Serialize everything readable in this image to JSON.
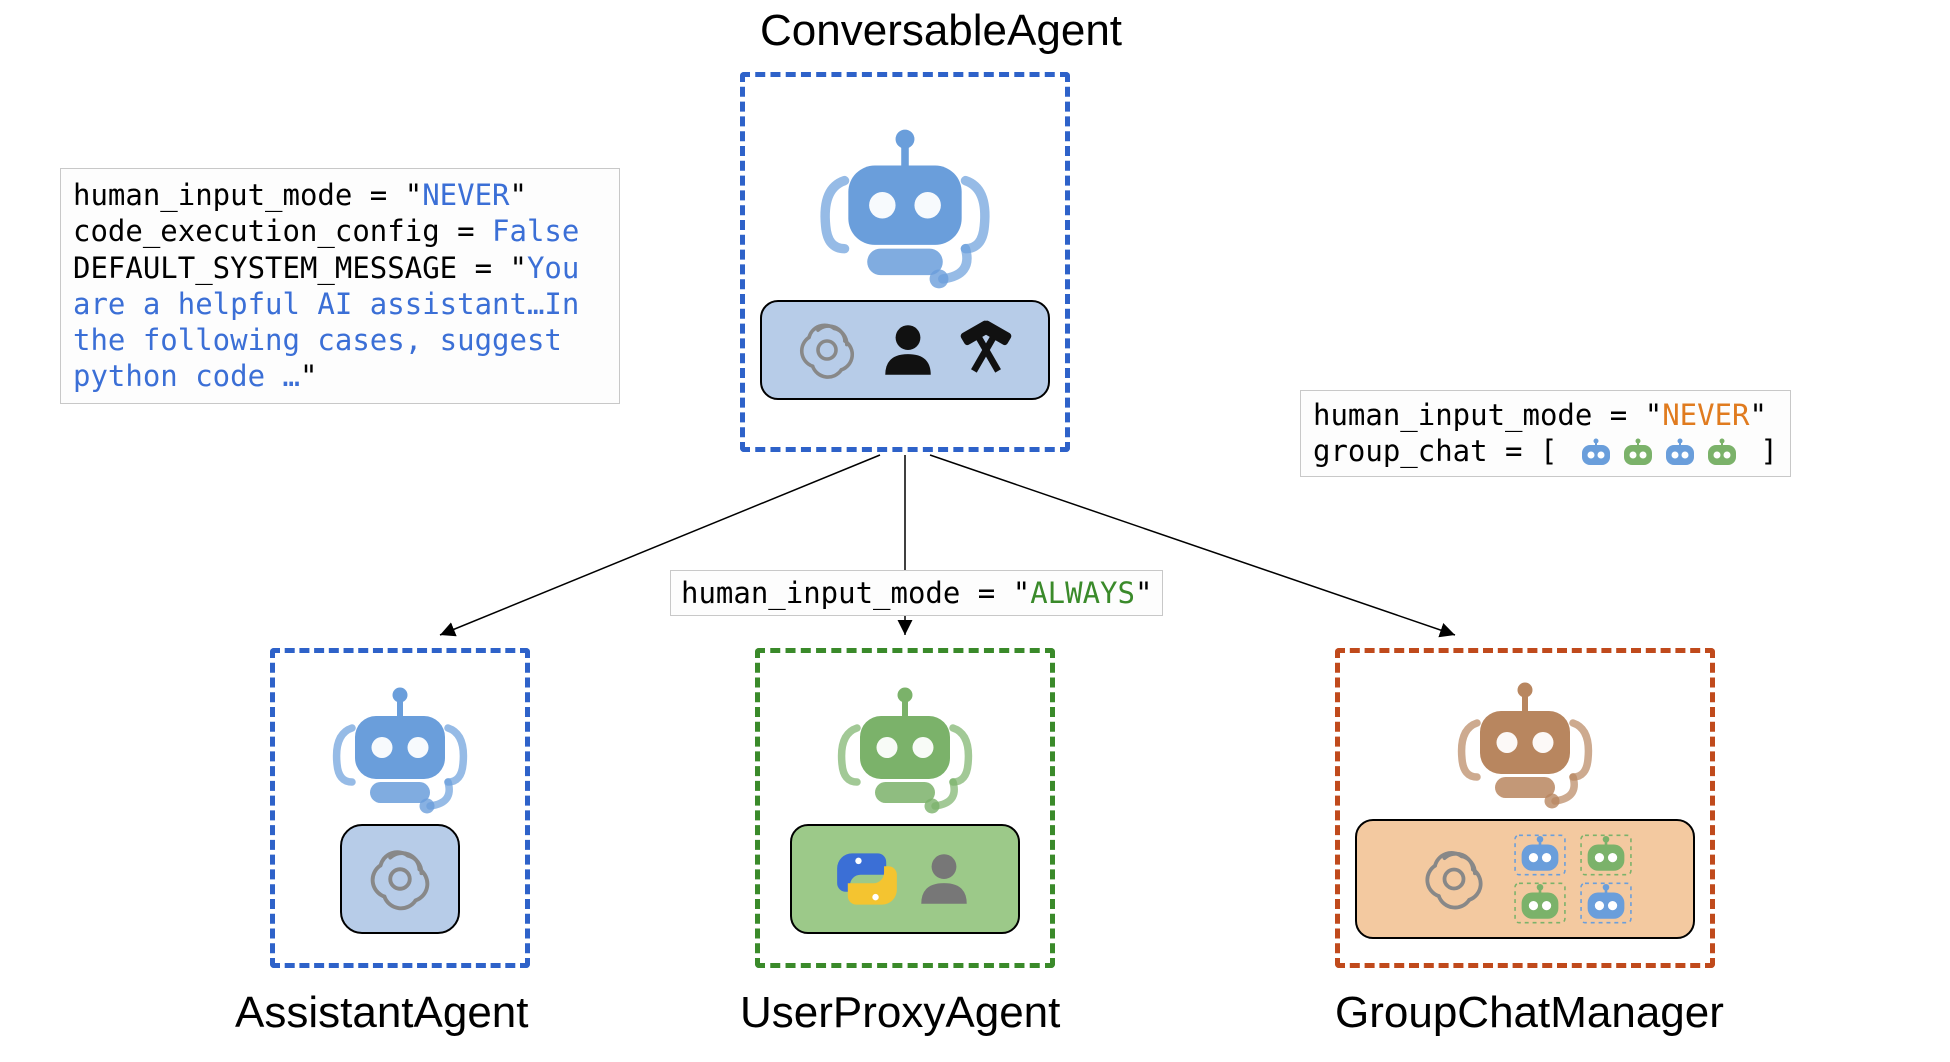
{
  "titles": {
    "top": "ConversableAgent",
    "assistant": "AssistantAgent",
    "userproxy": "UserProxyAgent",
    "groupchat": "GroupChatManager"
  },
  "codeLeft": {
    "l1a": "human_input_mode = \"",
    "l1b": "NEVER",
    "l1c": "\"",
    "l2a": "code_execution_config = ",
    "l2b": "False",
    "l3a": "DEFAULT_SYSTEM_MESSAGE = \"",
    "l3b": "You",
    "l4": "are a helpful AI assistant…In",
    "l5": "the following cases, suggest",
    "l6a": "python code …",
    "l6b": "\""
  },
  "codeMid": {
    "a": "human_input_mode = \"",
    "b": "ALWAYS",
    "c": "\""
  },
  "codeRight": {
    "l1a": "human_input_mode = \"",
    "l1b": "NEVER",
    "l1c": "\"",
    "l2a": "group_chat = [ ",
    "l2b": " ]"
  },
  "colors": {
    "blue": "#3b6fd6",
    "blueBorder": "#2e62c9",
    "blueFill": "#b7cce8",
    "green": "#3a8a2a",
    "greenBorder": "#3a8a2a",
    "greenFill": "#9cc989",
    "brown": "#c04a1c",
    "brownBorder": "#c04a1c",
    "brownFill": "#f3c9a0",
    "robotBlueBody": "#6a9edb",
    "robotBlueHead": "#6a9edb",
    "robotGreenBody": "#7bb26a",
    "robotBrownBody": "#b8865f"
  }
}
